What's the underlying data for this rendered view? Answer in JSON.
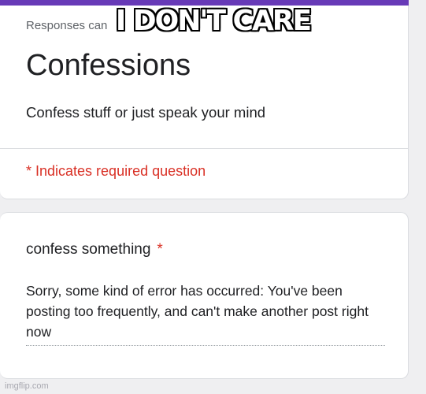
{
  "colors": {
    "accent": "#673ab7",
    "required": "#d93025",
    "background": "#efeff1"
  },
  "form": {
    "notice_partial": "Responses can",
    "title": "Confessions",
    "description": "Confess stuff or just speak your mind",
    "required_note": "* Indicates required question"
  },
  "question": {
    "label": "confess something",
    "required_marker": "*",
    "answer_text": "Sorry, some kind of error has occurred: You've been posting too frequently, and can't make another post right now"
  },
  "meme": {
    "caption": "I DON'T CARE",
    "watermark": "imgflip.com"
  }
}
